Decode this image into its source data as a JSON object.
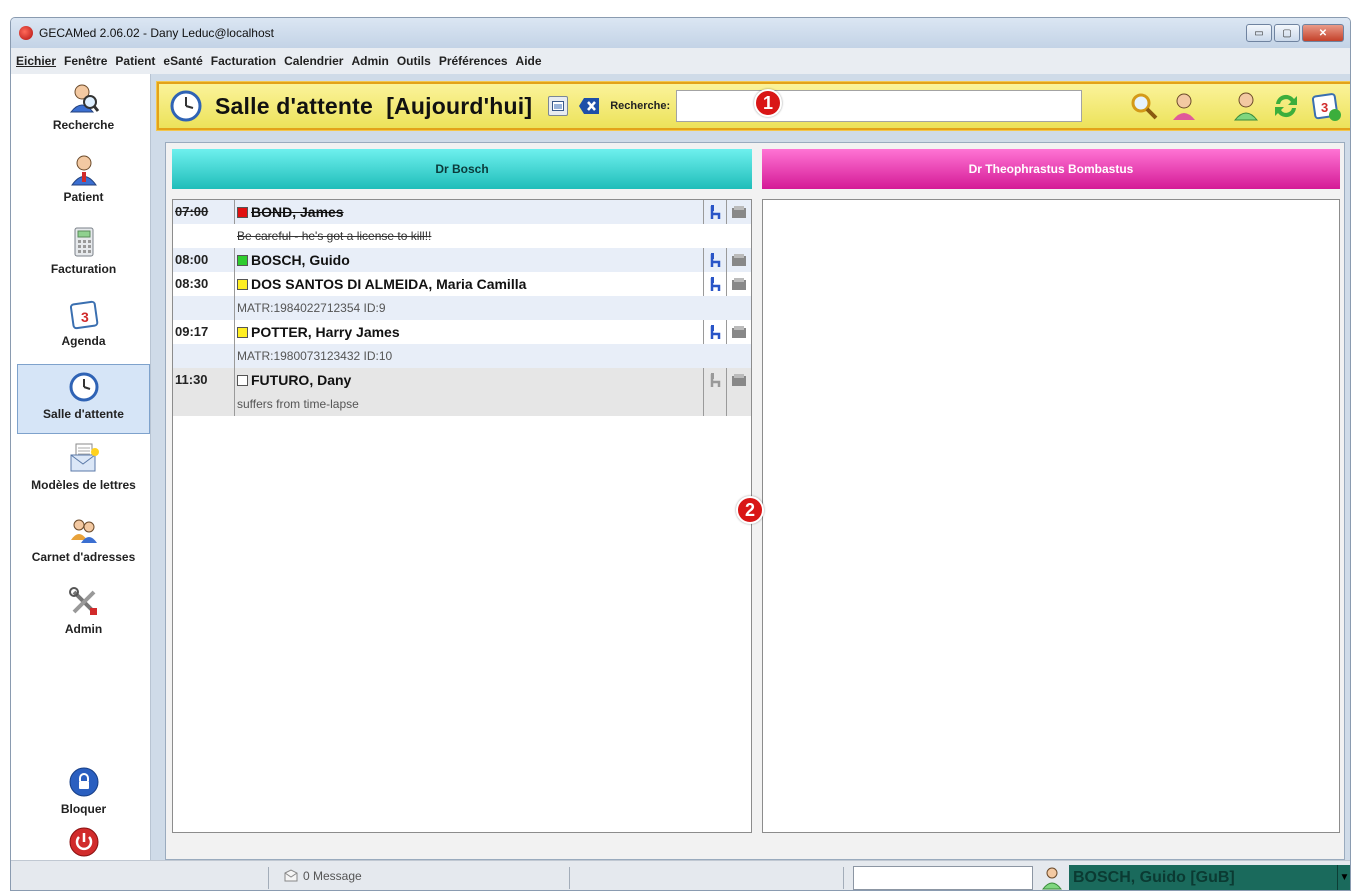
{
  "window": {
    "title": "GECAMed 2.06.02 - Dany Leduc@localhost",
    "controls": {
      "minimize": "▭",
      "maximize": "▢",
      "close": "✕"
    }
  },
  "menu": [
    "Eichier",
    "Fenêtre",
    "Patient",
    "eSanté",
    "Facturation",
    "Calendrier",
    "Admin",
    "Outils",
    "Préférences",
    "Aide"
  ],
  "sidebar": {
    "items": [
      {
        "label": "Recherche",
        "icon": "search-person-icon"
      },
      {
        "label": "Patient",
        "icon": "patient-icon"
      },
      {
        "label": "Facturation",
        "icon": "calculator-icon"
      },
      {
        "label": "Agenda",
        "icon": "calendar-icon"
      },
      {
        "label": "Salle d'attente",
        "icon": "clock-icon",
        "active": true
      },
      {
        "label": "Modèles de lettres",
        "icon": "letter-icon"
      },
      {
        "label": "Carnet d'adresses",
        "icon": "addressbook-icon"
      },
      {
        "label": "Admin",
        "icon": "tools-icon"
      }
    ],
    "lock_label": "Bloquer"
  },
  "toolbar": {
    "title": "Salle d'attente  [Aujourd'hui]",
    "search_label": "Recherche:",
    "search_value": "",
    "badge1": "1"
  },
  "badge2": "2",
  "columns": {
    "left": {
      "doctor": "Dr Bosch",
      "color": "#1fbdb9"
    },
    "right": {
      "doctor": "Dr Theophrastus Bombastus",
      "color": "#d41a96"
    }
  },
  "appointments": [
    {
      "time": "07:00",
      "status_color": "#e01010",
      "name": "BOND, James",
      "note": "Be careful - he's got a license to kill!!",
      "struck": true
    },
    {
      "time": "08:00",
      "status_color": "#2ecc2e",
      "name": "BOSCH, Guido",
      "note": "",
      "struck": false
    },
    {
      "time": "08:30",
      "status_color": "#ffee22",
      "name": "DOS SANTOS DI ALMEIDA, Maria Camilla",
      "note": "MATR:1984022712354 ID:9",
      "struck": false
    },
    {
      "time": "09:17",
      "status_color": "#ffee22",
      "name": "POTTER, Harry James",
      "note": "MATR:1980073123432 ID:10",
      "struck": false
    },
    {
      "time": "11:30",
      "status_color": "#ffffff",
      "name": "FUTURO, Dany",
      "note": "suffers from time-lapse",
      "struck": false
    }
  ],
  "statusbar": {
    "messages": "0 Message",
    "current_user": "BOSCH, Guido [GuB]"
  }
}
